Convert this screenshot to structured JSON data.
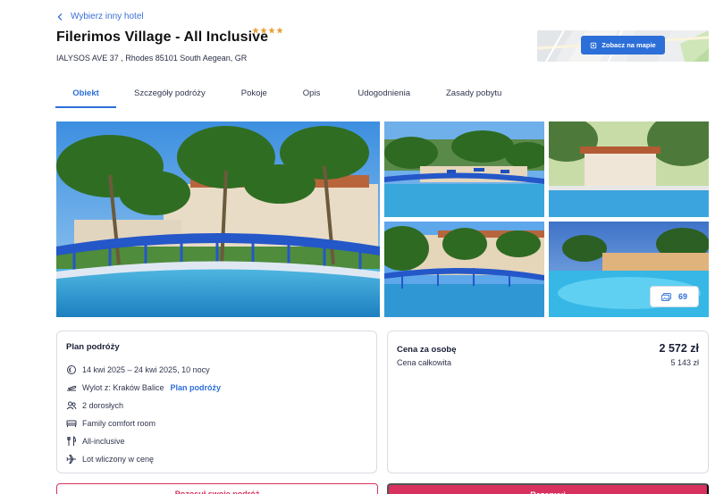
{
  "back_link": "Wybierz inny hotel",
  "hotel": {
    "name": "Filerimos Village - All Inclusive",
    "stars": 4,
    "address": "IALYSOS AVE 37 , Rhodes 85101 South Aegean, GR"
  },
  "map": {
    "button_label": "Zobacz na mapie"
  },
  "tabs": [
    {
      "label": "Obiekt",
      "active": true
    },
    {
      "label": "Szczegóły podróży",
      "active": false
    },
    {
      "label": "Pokoje",
      "active": false
    },
    {
      "label": "Opis",
      "active": false
    },
    {
      "label": "Udogodnienia",
      "active": false
    },
    {
      "label": "Zasady pobytu",
      "active": false
    }
  ],
  "gallery": {
    "photo_count": "69"
  },
  "plan": {
    "title": "Plan podróży",
    "dates": "14 kwi 2025 – 24 kwi 2025, 10 nocy",
    "departure": "Wylot z: Kraków Balice",
    "departure_link": "Plan podróży",
    "guests": "2 dorosłych",
    "room": "Family comfort room",
    "board": "All-inclusive",
    "flight": "Lot wliczony w cenę"
  },
  "price": {
    "per_person_label": "Cena za osobę",
    "per_person_value": "2 572 zł",
    "total_label": "Cena całkowita",
    "total_value": "5 143 zł"
  },
  "actions": {
    "share_label": "Pozosuł swoje podróż",
    "book_label": "Rezerwuj"
  },
  "colors": {
    "accent": "#2d6fd8",
    "star": "#e9a23b",
    "cta": "#d8315f"
  }
}
